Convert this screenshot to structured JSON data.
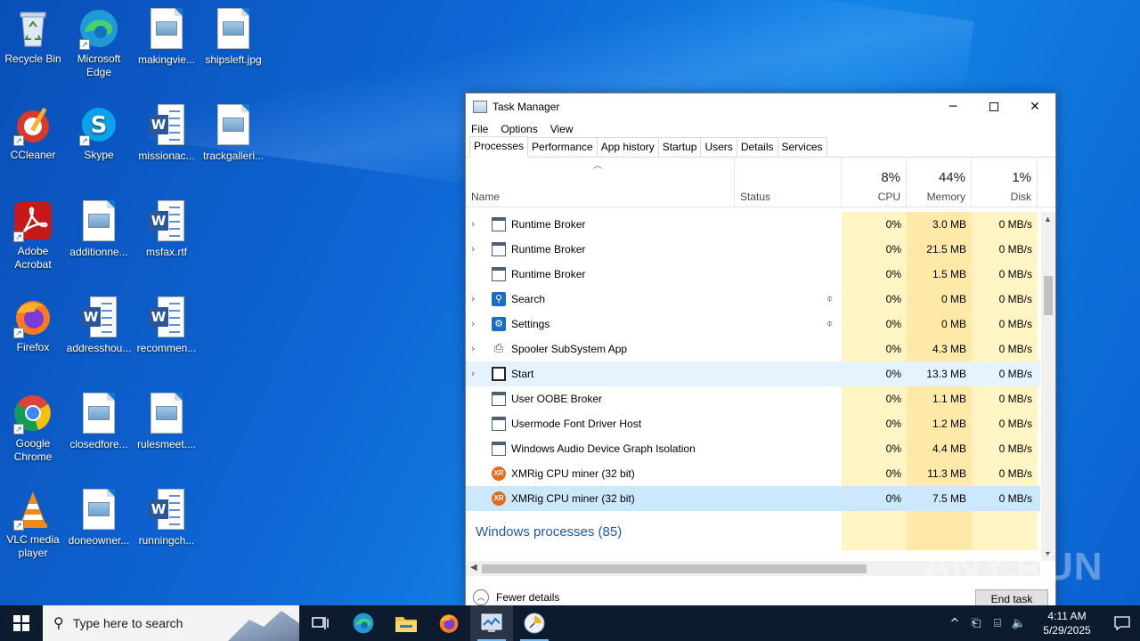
{
  "desktop": {
    "icons": [
      {
        "label": "Recycle Bin"
      },
      {
        "label": "Microsoft Edge"
      },
      {
        "label": "makingvie..."
      },
      {
        "label": "shipsleft.jpg"
      },
      {
        "label": "CCleaner"
      },
      {
        "label": "Skype"
      },
      {
        "label": "missionac..."
      },
      {
        "label": "trackgalleri..."
      },
      {
        "label": "Adobe Acrobat"
      },
      {
        "label": "additionne..."
      },
      {
        "label": "msfax.rtf"
      },
      {
        "label": "Firefox"
      },
      {
        "label": "addresshou..."
      },
      {
        "label": "recommen..."
      },
      {
        "label": "Google Chrome"
      },
      {
        "label": "closedfore..."
      },
      {
        "label": "rulesmeet...."
      },
      {
        "label": "VLC media player"
      },
      {
        "label": "doneowner..."
      },
      {
        "label": "runningch..."
      }
    ]
  },
  "taskmanager": {
    "title": "Task Manager",
    "menu": [
      "File",
      "Options",
      "View"
    ],
    "tabs": [
      "Processes",
      "Performance",
      "App history",
      "Startup",
      "Users",
      "Details",
      "Services"
    ],
    "active_tab": "Processes",
    "columns": {
      "name": "Name",
      "status": "Status",
      "cpu_pct": "8%",
      "cpu": "CPU",
      "mem_pct": "44%",
      "mem": "Memory",
      "disk_pct": "1%",
      "disk": "Disk"
    },
    "rows": [
      {
        "name": "Runtime Broker",
        "cpu": "0%",
        "mem": "3.0 MB",
        "disk": "0 MB/s"
      },
      {
        "name": "Runtime Broker",
        "cpu": "0%",
        "mem": "21.5 MB",
        "disk": "0 MB/s"
      },
      {
        "name": "Runtime Broker",
        "cpu": "0%",
        "mem": "1.5 MB",
        "disk": "0 MB/s"
      },
      {
        "name": "Search",
        "cpu": "0%",
        "mem": "0 MB",
        "disk": "0 MB/s"
      },
      {
        "name": "Settings",
        "cpu": "0%",
        "mem": "0 MB",
        "disk": "0 MB/s"
      },
      {
        "name": "Spooler SubSystem App",
        "cpu": "0%",
        "mem": "4.3 MB",
        "disk": "0 MB/s"
      },
      {
        "name": "Start",
        "cpu": "0%",
        "mem": "13.3 MB",
        "disk": "0 MB/s"
      },
      {
        "name": "User OOBE Broker",
        "cpu": "0%",
        "mem": "1.1 MB",
        "disk": "0 MB/s"
      },
      {
        "name": "Usermode Font Driver Host",
        "cpu": "0%",
        "mem": "1.2 MB",
        "disk": "0 MB/s"
      },
      {
        "name": "Windows Audio Device Graph Isolation",
        "cpu": "0%",
        "mem": "4.4 MB",
        "disk": "0 MB/s"
      },
      {
        "name": "XMRig CPU miner (32 bit)",
        "cpu": "0%",
        "mem": "11.3 MB",
        "disk": "0 MB/s"
      },
      {
        "name": "XMRig CPU miner (32 bit)",
        "cpu": "0%",
        "mem": "7.5 MB",
        "disk": "0 MB/s"
      }
    ],
    "group_label": "Windows processes (85)",
    "fewer_details": "Fewer details",
    "end_task": "End task"
  },
  "watermark": "ANY.RUN",
  "taskbar": {
    "search_placeholder": "Type here to search",
    "time": "4:11 AM",
    "date": "5/29/2025"
  }
}
